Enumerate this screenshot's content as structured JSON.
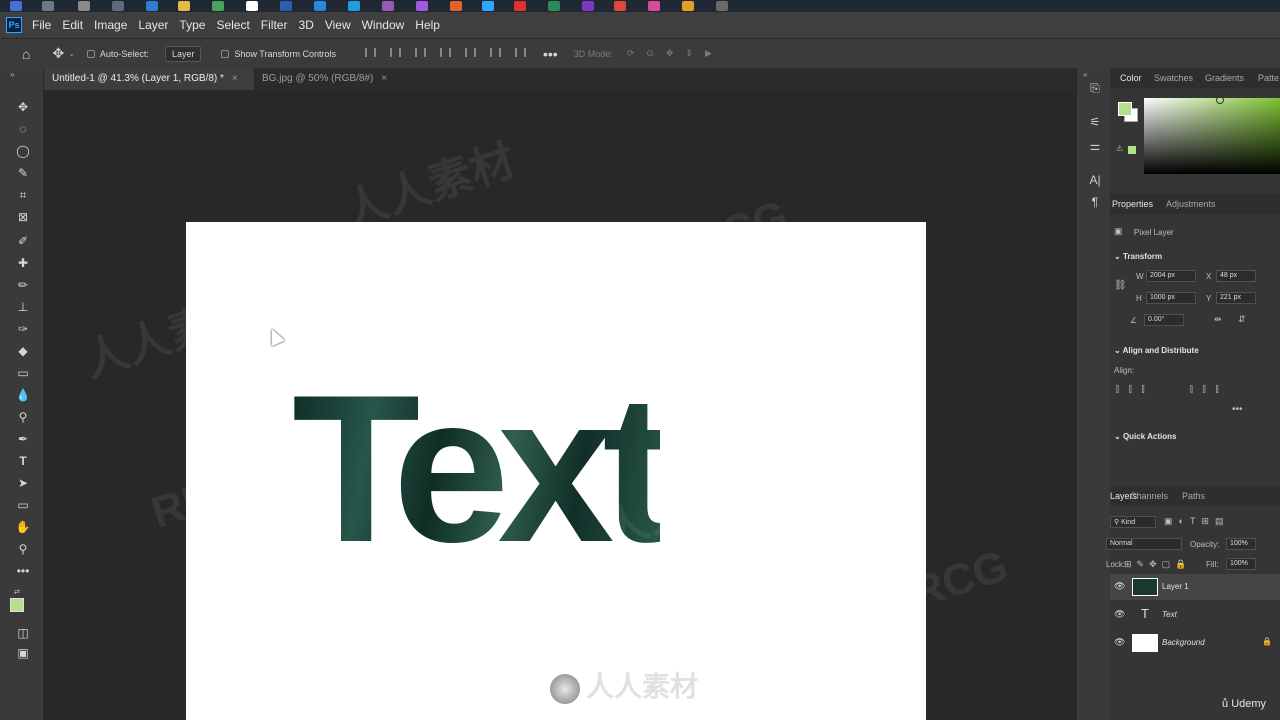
{
  "menu": {
    "items": [
      "File",
      "Edit",
      "Image",
      "Layer",
      "Type",
      "Select",
      "Filter",
      "3D",
      "View",
      "Window",
      "Help"
    ]
  },
  "options_bar": {
    "auto_select_label": "Auto-Select:",
    "auto_select_value": "Layer",
    "show_transform_label": "Show Transform Controls",
    "mode_3d_label": "3D Mode:"
  },
  "tabs": [
    {
      "label": "Untitled-1 @ 41.3% (Layer 1, RGB/8) *",
      "active": true
    },
    {
      "label": "BG.jpg @ 50% (RGB/8#)",
      "active": false
    }
  ],
  "canvas": {
    "text": "Text"
  },
  "color_panel": {
    "tabs": [
      "Color",
      "Swatches",
      "Gradients",
      "Patte"
    ],
    "foreground": "#b4e08c",
    "background": "#ffffff"
  },
  "properties_panel": {
    "tabs": [
      "Properties",
      "Adjustments"
    ],
    "layer_type": "Pixel Layer",
    "transform_title": "Transform",
    "w_label": "W",
    "w_value": "2004 px",
    "h_label": "H",
    "h_value": "1000 px",
    "x_label": "X",
    "x_value": "48 px",
    "y_label": "Y",
    "y_value": "221 px",
    "angle_value": "0.00°",
    "align_title": "Align and Distribute",
    "align_label": "Align:",
    "quick_actions_title": "Quick Actions"
  },
  "layers_panel": {
    "tabs": [
      "Layers",
      "Channels",
      "Paths"
    ],
    "filter_label": "Kind",
    "blend_mode": "Normal",
    "opacity_label": "Opacity:",
    "opacity_value": "100%",
    "lock_label": "Lock:",
    "fill_label": "Fill:",
    "fill_value": "100%",
    "layers": [
      {
        "name": "Layer 1",
        "type": "pixel"
      },
      {
        "name": "Text",
        "type": "type"
      },
      {
        "name": "Background",
        "type": "background"
      }
    ]
  },
  "watermarks": {
    "brand": "人人素材",
    "logo_text": "RRCG",
    "udemy": "Udemy"
  },
  "colors": {
    "accent": "#31a8ff",
    "app_bg": "#282828",
    "panel_bg": "#353535"
  }
}
